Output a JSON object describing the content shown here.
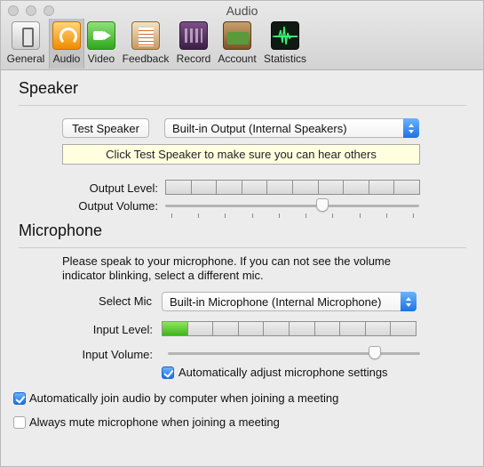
{
  "window": {
    "title": "Audio"
  },
  "toolbar": {
    "items": [
      {
        "label": "General",
        "icon": "general-icon",
        "active": false
      },
      {
        "label": "Audio",
        "icon": "headphones-icon",
        "active": true
      },
      {
        "label": "Video",
        "icon": "video-camera-icon",
        "active": false
      },
      {
        "label": "Feedback",
        "icon": "clipboard-icon",
        "active": false
      },
      {
        "label": "Record",
        "icon": "film-strip-icon",
        "active": false
      },
      {
        "label": "Account",
        "icon": "wallet-icon",
        "active": false
      },
      {
        "label": "Statistics",
        "icon": "waveform-icon",
        "active": false
      }
    ]
  },
  "speaker": {
    "title": "Speaker",
    "test_button": "Test Speaker",
    "device": "Built-in Output (Internal Speakers)",
    "tooltip": "Click Test Speaker to make sure you can hear others",
    "output_level_label": "Output Level:",
    "output_level_segments": 10,
    "output_level_active": 0,
    "output_volume_label": "Output Volume:",
    "output_volume": 0.62
  },
  "microphone": {
    "title": "Microphone",
    "instructions": "Please speak to your microphone. If you can not see the volume indicator blinking, select a different mic.",
    "select_label": "Select Mic",
    "device": "Built-in Microphone (Internal Microphone)",
    "input_level_label": "Input Level:",
    "input_level_segments": 10,
    "input_level_active": 1,
    "input_volume_label": "Input Volume:",
    "input_volume": 0.82,
    "auto_adjust_label": "Automatically adjust microphone settings",
    "auto_adjust_checked": true
  },
  "options": {
    "auto_join_label": "Automatically join audio by computer when joining a meeting",
    "auto_join_checked": true,
    "mute_label": "Always mute microphone when joining a meeting",
    "mute_checked": false
  },
  "colors": {
    "accent": "#1b72e8",
    "meter_on": "#3fb41b",
    "tooltip_bg": "#ffffe0"
  }
}
